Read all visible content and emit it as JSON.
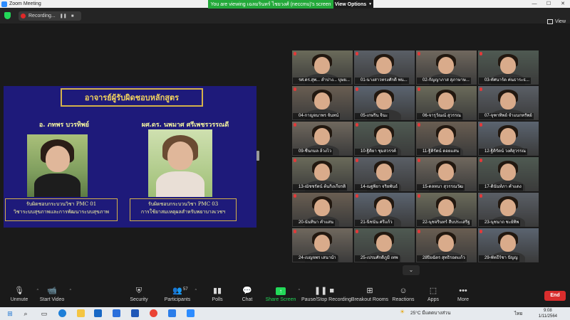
{
  "window": {
    "title": "Zoom Meeting"
  },
  "meeting": {
    "recording_label": "Recording...",
    "viewing_banner": "You are viewing เฉลมรินทร์ ไชยวงศ์ (neccmu)'s screen",
    "view_options": "View Options",
    "view_label": "View"
  },
  "slide": {
    "title": "อาจารย์ผู้รับผิดชอบหลักสูตร",
    "left_name": "อ. ภทพร บวรทิพย์",
    "left_resp_1": "รับผิดชอบกระบวนวิชา PMC 01",
    "left_resp_2": "วิชาระบบสุขภาพและการพัฒนาระบบสุขภาพ",
    "right_name": "ผศ.ดร. นพมาศ ศรีเพชรวรรณดี",
    "right_resp_1": "รับผิดชอบกระบวนวิชา PMC 03",
    "right_resp_2": "การใช้ยาสมเหตุผลสำหรับพยาบาลเวชฯ"
  },
  "participants": [
    {
      "name": "รศ.ดร.สุพ... ลำปาง... บุษย..."
    },
    {
      "name": "01-นางสาวทรงศักดิ์ พน..."
    },
    {
      "name": "02-กัญญาภาส สุภาษาษ..."
    },
    {
      "name": "03-ทัศนาร์ด ค่นธาระธ..."
    },
    {
      "name": "04-กาญจนาพร จันทน์"
    },
    {
      "name": "05-เกษริน จินะ"
    },
    {
      "name": "06-จารุวัณณ์ สุวรรณ"
    },
    {
      "name": "07-จุฑาทิพย์ จำแนกทรัพย์"
    },
    {
      "name": "09-ชื่นกมล ล้วงไว"
    },
    {
      "name": "10-ฐิติยา ชุมสวรรค์"
    },
    {
      "name": "11-ฐิติรัตน์ ดอยแสน"
    },
    {
      "name": "12-ฐิติรัตน์ วงศ์สุวรรณ"
    },
    {
      "name": "13-ณัชชรัตน์ ต้นกิ่งเกียรติ"
    },
    {
      "name": "14-ณฐพิยา จริยพันธ์"
    },
    {
      "name": "15-ดลหนา สุวรรณวัฒ"
    },
    {
      "name": "17-ตินันท์ภา คำแดง"
    },
    {
      "name": "20-นันทินา คำแสน"
    },
    {
      "name": "21-นิชนัน ศรีแก้ว"
    },
    {
      "name": "22-นุชจรินทร์ สืบประเสริฐ"
    },
    {
      "name": "23-นุชนาถ ชะย์ทิพ"
    },
    {
      "name": "24-เบญจพร เสนานำ"
    },
    {
      "name": "25-เปรมศักดิ์ภูมิ์ เทพ"
    },
    {
      "name": "28ปิยฉัตร สุทธิรอดแก้ว"
    },
    {
      "name": "29-พัทธีร์ชา ปัญญ"
    }
  ],
  "toolbar": {
    "unmute": "Unmute",
    "start_video": "Start Video",
    "security": "Security",
    "participants": "Participants",
    "participants_count": "57",
    "polls": "Polls",
    "chat": "Chat",
    "share_screen": "Share Screen",
    "pause_recording": "Pause/Stop Recording",
    "breakout_rooms": "Breakout Rooms",
    "reactions": "Reactions",
    "apps": "Apps",
    "more": "More",
    "end": "End"
  },
  "taskbar": {
    "weather": "25°C มีแดดบางส่วน",
    "lang": "ไทย",
    "time": "9:08",
    "date": "1/11/2564"
  },
  "colors": {
    "zoom_green": "#23d959",
    "end_red": "#d92d2d",
    "slide_bg": "#1e1a7a",
    "slide_gold": "#d4b24a",
    "active_speaker": "#e8d01e"
  }
}
